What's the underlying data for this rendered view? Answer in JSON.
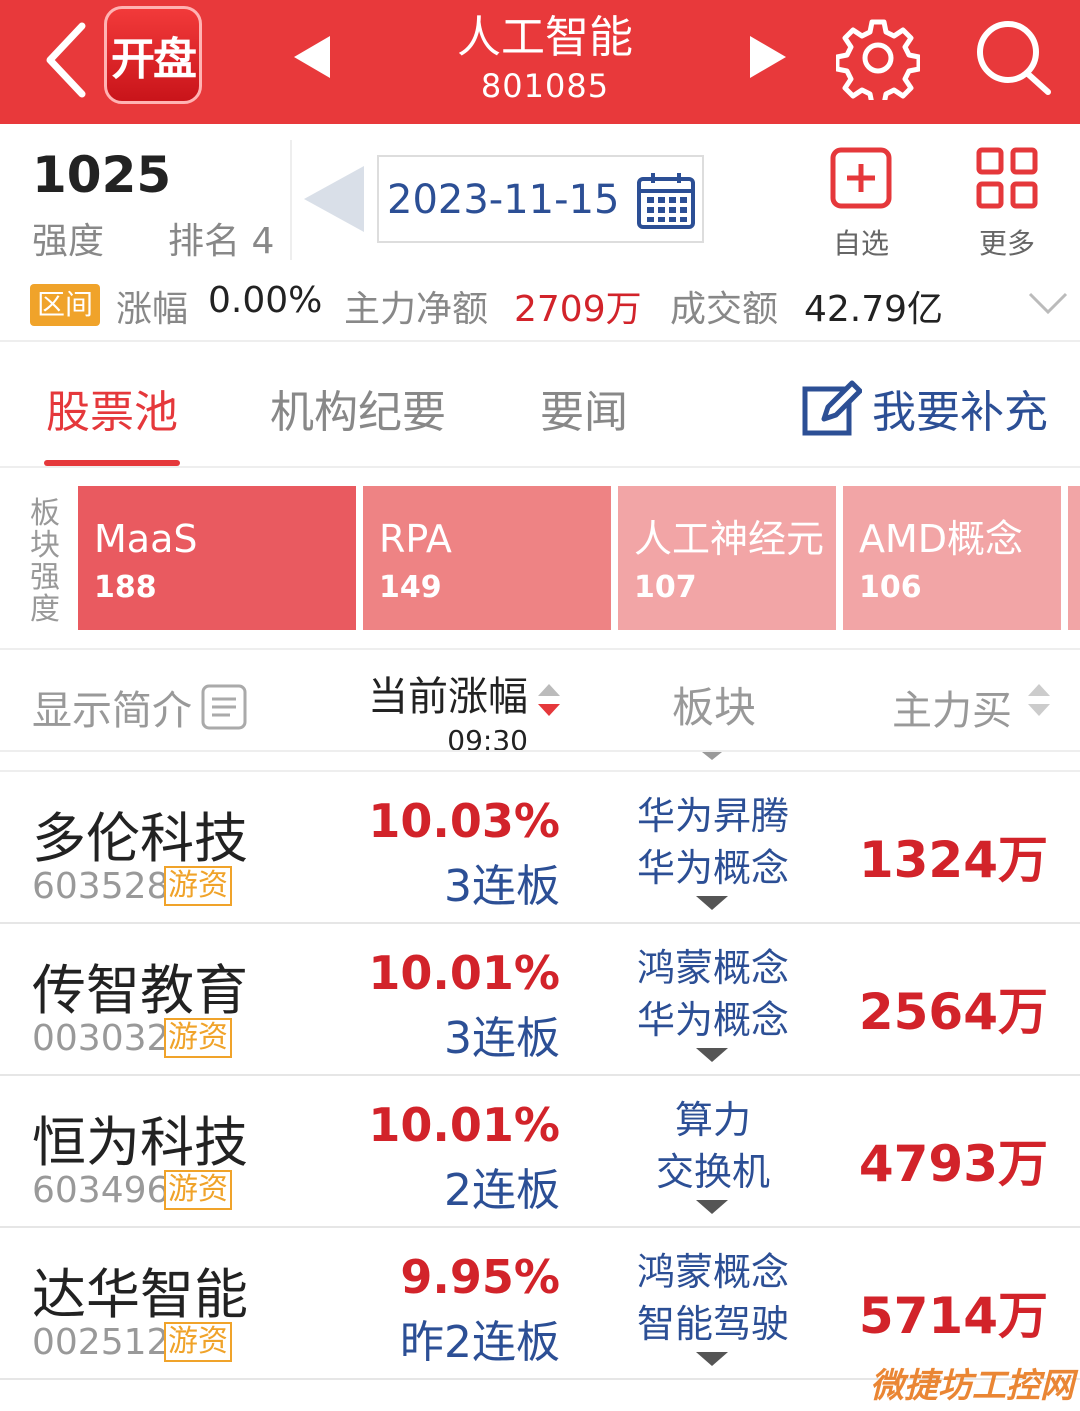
{
  "header": {
    "app_logo": "开盘",
    "title": "人工智能",
    "code": "801085"
  },
  "info": {
    "strength_value": "1025",
    "strength_label": "强度",
    "rank_label": "排名 4",
    "date": "2023-11-15",
    "watchlist_label": "自选",
    "more_label": "更多"
  },
  "stats": {
    "range_tag": "区间",
    "change_label": "涨幅",
    "change_value": "0.00%",
    "net_label": "主力净额",
    "net_value": "2709万",
    "turnover_label": "成交额",
    "turnover_value": "42.79亿"
  },
  "tabs": [
    {
      "label": "股票池",
      "active": true
    },
    {
      "label": "机构纪要",
      "active": false
    },
    {
      "label": "要闻",
      "active": false
    }
  ],
  "supplement_label": "我要补充",
  "sector_strength": {
    "label": "板块强度",
    "items": [
      {
        "name": "MaaS",
        "value": "188",
        "color": "#e95a60"
      },
      {
        "name": "RPA",
        "value": "149",
        "color": "#ee8384"
      },
      {
        "name": "人工神经元",
        "value": "107",
        "color": "#f2a5a6"
      },
      {
        "name": "AMD概念",
        "value": "106",
        "color": "#f2a5a6"
      }
    ]
  },
  "table_header": {
    "intro": "显示简介",
    "change": "当前涨幅",
    "change_time": "09:30",
    "sector": "板块",
    "main_buy": "主力买"
  },
  "rows": [
    {
      "name": "多伦科技",
      "code": "603528",
      "tag": "游资",
      "pct": "10.03%",
      "boards": "3连板",
      "sector1": "华为昇腾",
      "sector2": "华为概念",
      "amount": "1324万"
    },
    {
      "name": "传智教育",
      "code": "003032",
      "tag": "游资",
      "pct": "10.01%",
      "boards": "3连板",
      "sector1": "鸿蒙概念",
      "sector2": "华为概念",
      "amount": "2564万"
    },
    {
      "name": "恒为科技",
      "code": "603496",
      "tag": "游资",
      "pct": "10.01%",
      "boards": "2连板",
      "sector1": "算力",
      "sector2": "交换机",
      "amount": "4793万"
    },
    {
      "name": "达华智能",
      "code": "002512",
      "tag": "游资",
      "pct": "9.95%",
      "boards": "昨2连板",
      "sector1": "鸿蒙概念",
      "sector2": "智能驾驶",
      "amount": "5714万"
    }
  ],
  "watermark": "微捷坊工控网"
}
